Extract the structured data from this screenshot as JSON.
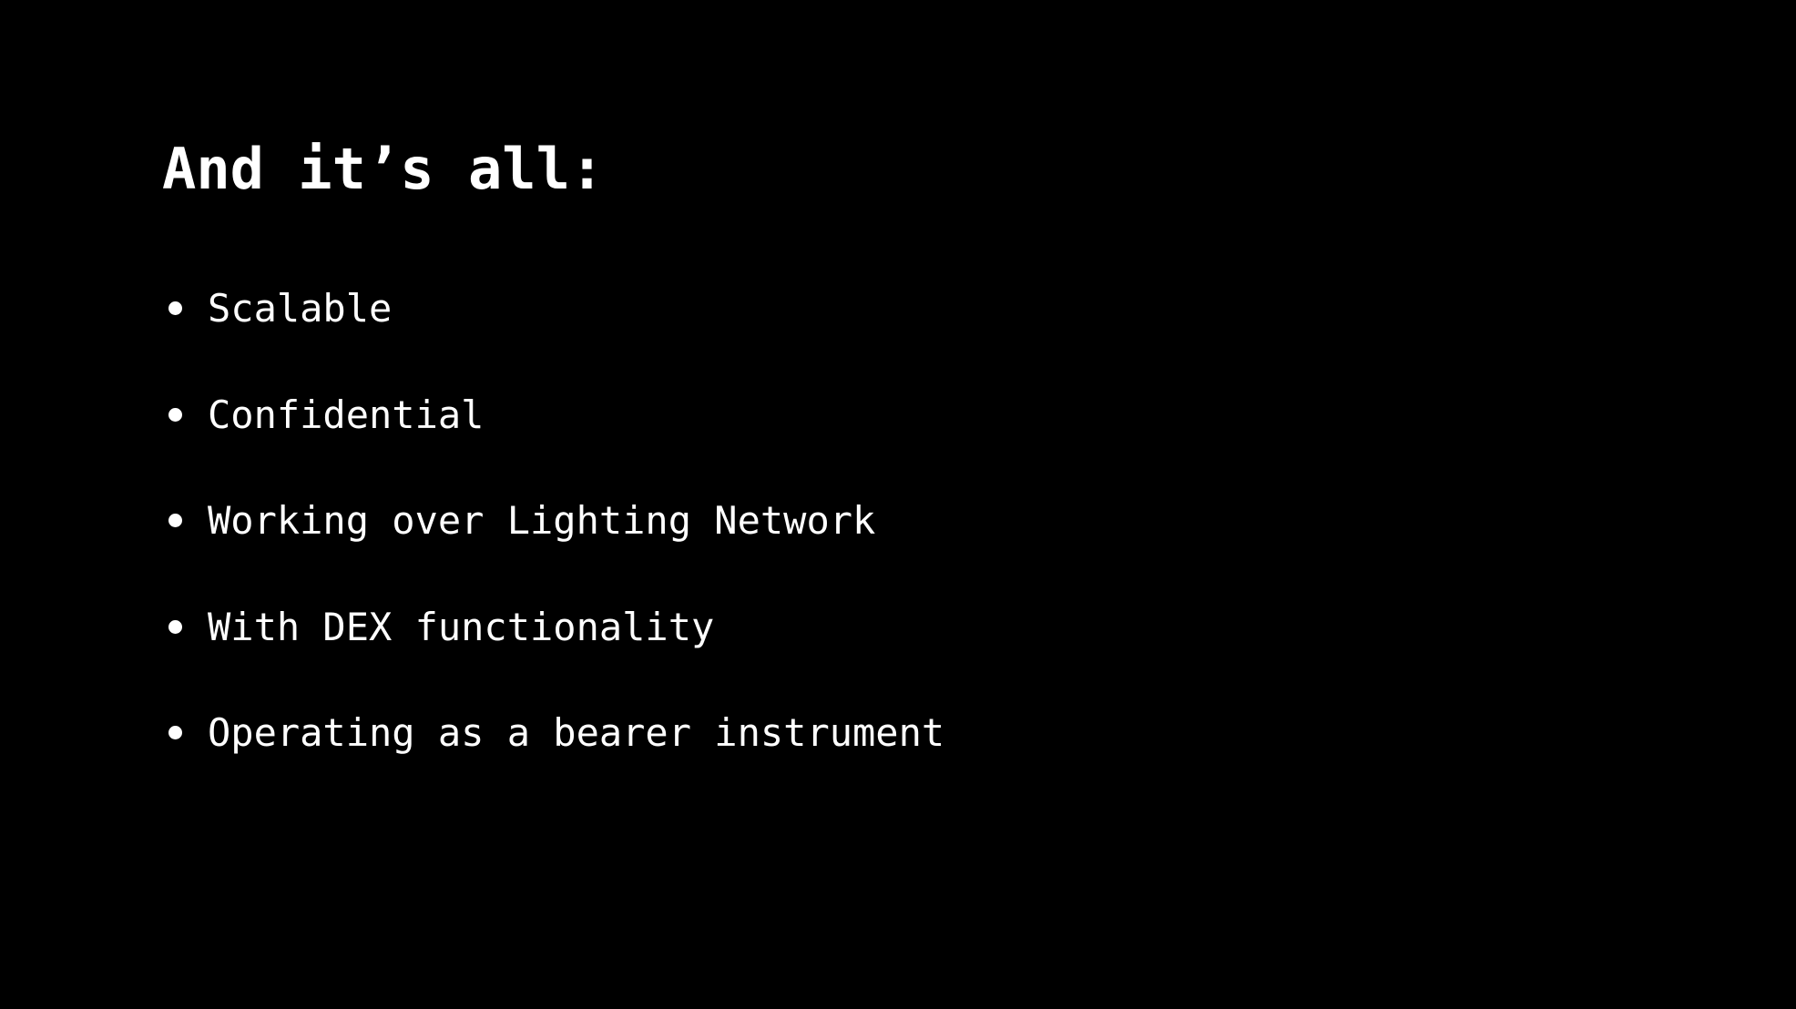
{
  "slide": {
    "title": "And it’s all:",
    "bullets": [
      {
        "text": "Scalable"
      },
      {
        "text": "Confidential"
      },
      {
        "text": "Working over Lighting Network"
      },
      {
        "text": "With DEX functionality"
      },
      {
        "text": "Operating as a bearer instrument"
      }
    ]
  },
  "colors": {
    "background": "#000000",
    "text": "#ffffff"
  }
}
